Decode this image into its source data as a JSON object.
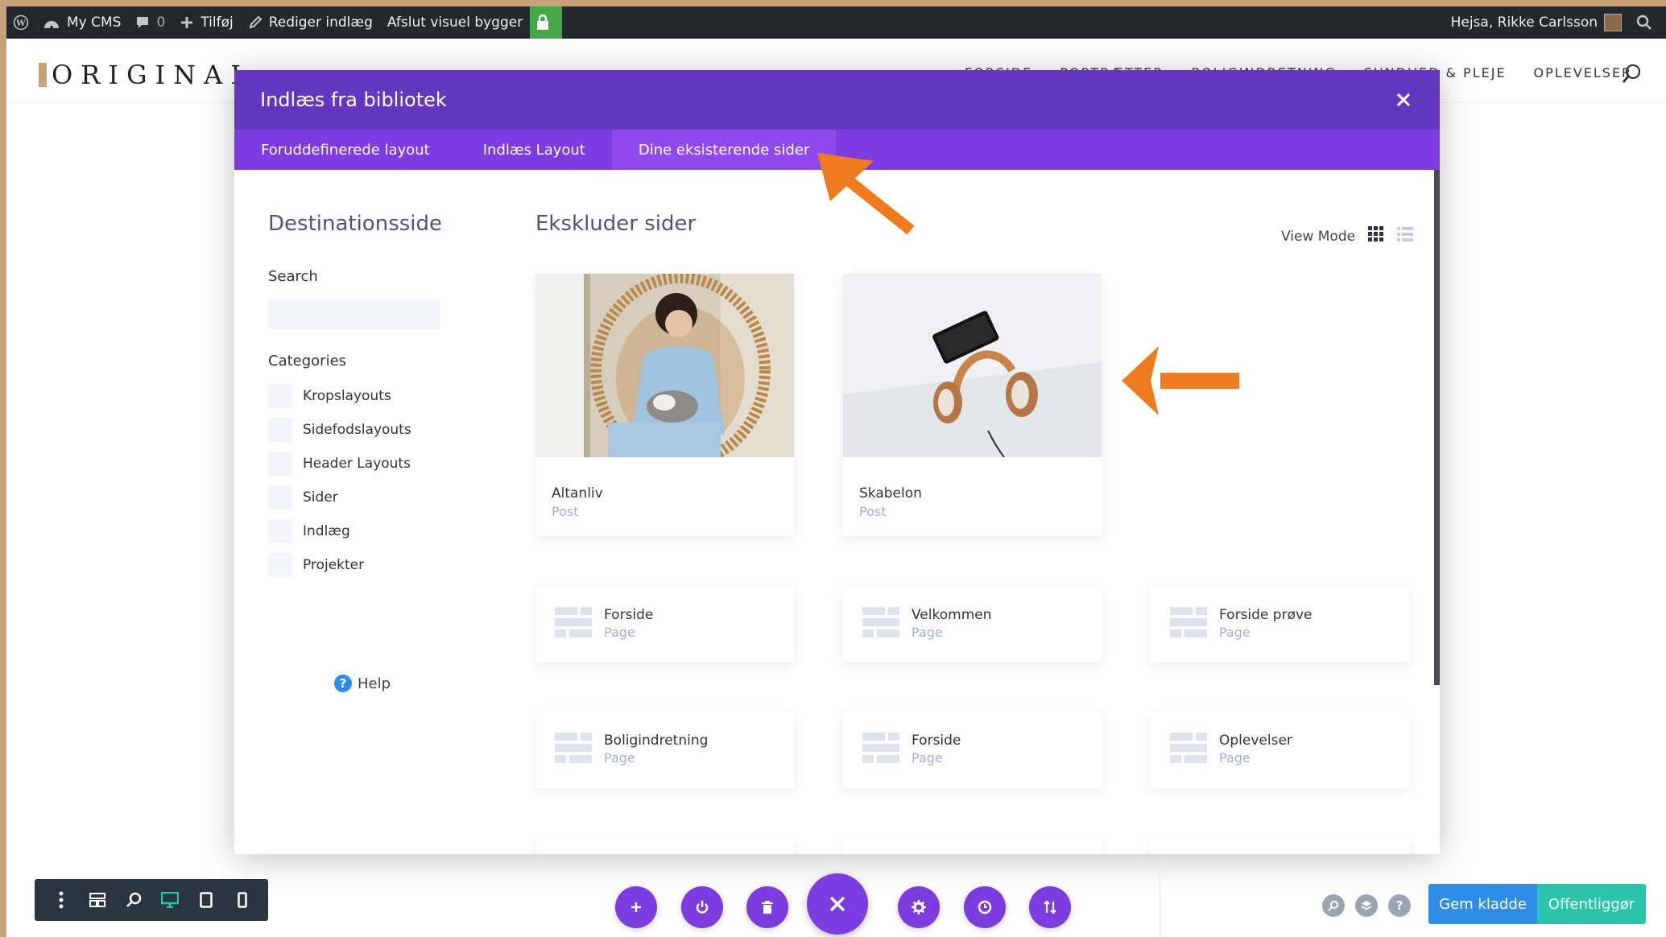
{
  "admin_bar": {
    "site_name": "My CMS",
    "comments_count": "0",
    "add_new": "Tilføj",
    "edit_post": "Rediger indlæg",
    "exit_builder": "Afslut visuel bygger",
    "greeting": "Hejsa, Rikke Carlsson"
  },
  "site": {
    "logo_text": "ORIGINAL",
    "nav": [
      "FORSIDE",
      "PORTRÆTTER",
      "BOLIGINDRETNING",
      "SUNDHED & PLEJE",
      "OPLEVELSER"
    ]
  },
  "modal": {
    "title": "Indlæs fra bibliotek",
    "tabs": [
      {
        "label": "Foruddefinerede layout",
        "active": false
      },
      {
        "label": "Indlæs Layout",
        "active": false
      },
      {
        "label": "Dine eksisterende sider",
        "active": true
      }
    ],
    "sidebar": {
      "title": "Destinationsside",
      "search_label": "Search",
      "search_value": "",
      "categories_label": "Categories",
      "categories": [
        "Kropslayouts",
        "Sidefodslayouts",
        "Header Layouts",
        "Sider",
        "Indlæg",
        "Projekter"
      ],
      "help": "Help"
    },
    "content_title": "Ekskluder sider",
    "view_mode_label": "View Mode",
    "post_cards": [
      {
        "title": "Altanliv",
        "type": "Post"
      },
      {
        "title": "Skabelon",
        "type": "Post"
      }
    ],
    "page_cards": [
      {
        "title": "Forside",
        "type": "Page"
      },
      {
        "title": "Velkommen",
        "type": "Page"
      },
      {
        "title": "Forside prøve",
        "type": "Page"
      },
      {
        "title": "Boligindretning",
        "type": "Page"
      },
      {
        "title": "Forside",
        "type": "Page"
      },
      {
        "title": "Oplevelser",
        "type": "Page"
      }
    ]
  },
  "builder": {
    "save_draft": "Gem kladde",
    "publish": "Offentliggør"
  },
  "colors": {
    "modal_header": "#6437c1",
    "modal_tabs": "#7e3be0",
    "arrow": "#f07b1e",
    "save_draft": "#2e8ee6",
    "publish": "#29c4a9"
  }
}
